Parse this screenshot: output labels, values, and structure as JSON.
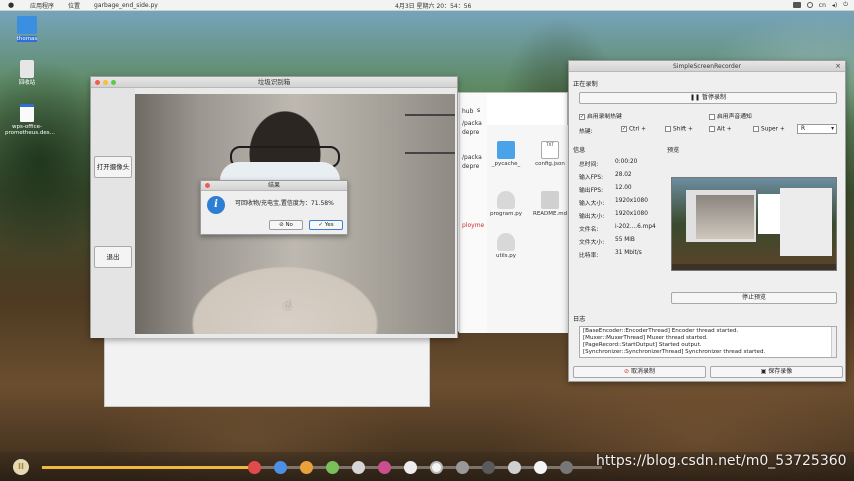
{
  "topbar": {
    "apple": "",
    "menu_apps": "应用程序",
    "menu_places": "位置",
    "menu_file": "garbage_end_side.py",
    "clock": "4月3日 星期六  20：54：56",
    "lang": "cn"
  },
  "desktop": {
    "icons": [
      {
        "label": "thomas"
      },
      {
        "label": "回收站"
      },
      {
        "label": "wps-office-prometheus.des..."
      }
    ]
  },
  "camera_app": {
    "title": "垃圾识别箱",
    "open_camera": "打开摄像头",
    "exit": "退出"
  },
  "result_dialog": {
    "title": "结果",
    "message": "可回收物/充电宝,置信度为：71.58%",
    "no": "No",
    "yes": "Yes"
  },
  "file_manager": {
    "path_items": [
      "hub",
      "s",
      "/packa",
      "depre",
      "/packa",
      "depre",
      "ployme"
    ],
    "files": [
      {
        "name": "_pycache_",
        "type": "folder"
      },
      {
        "name": "config.json",
        "type": "txt"
      },
      {
        "name": "program.py",
        "type": "py"
      },
      {
        "name": "README.md",
        "type": "md"
      },
      {
        "name": "utils.py",
        "type": "py"
      }
    ],
    "txt_badge": "TXT"
  },
  "ssr": {
    "title": "SimpleScreenRecorder",
    "recording_header": "正在录制",
    "pause_button": "暂停录制",
    "enable_hotkey": "启用录制热键",
    "enable_sound": "启用声音通知",
    "hotkey_label": "热键:",
    "hotkey_ctrl": "Ctrl +",
    "hotkey_shift": "Shift +",
    "hotkey_alt": "Alt +",
    "hotkey_super": "Super +",
    "hotkey_key": "R",
    "info_header": "信息",
    "preview_header": "预览",
    "info": [
      {
        "label": "总时间:",
        "value": "0:00:20"
      },
      {
        "label": "输入FPS:",
        "value": "28.02"
      },
      {
        "label": "输出FPS:",
        "value": "12.00"
      },
      {
        "label": "输入大小:",
        "value": "1920x1080"
      },
      {
        "label": "输出大小:",
        "value": "1920x1080"
      },
      {
        "label": "文件名:",
        "value": "i-202....6.mp4"
      },
      {
        "label": "文件大小:",
        "value": "55 MiB"
      },
      {
        "label": "比特率:",
        "value": "31 Mbit/s"
      }
    ],
    "stop_preview": "停止预览",
    "log_header": "日志",
    "log_lines": [
      "[BaseEncoder::EncoderThread] Encoder thread started.",
      "[Muxer::MuxerThread] Muxer thread started.",
      "[PageRecord::StartOutput] Started output.",
      "[Synchronizer::SynchronizerThread] Synchronizer thread started."
    ],
    "cancel_button": "取消录制",
    "save_button": "保存录像"
  },
  "player": {
    "progress": 0.37
  },
  "watermark": "https://blog.csdn.net/m0_53725360"
}
